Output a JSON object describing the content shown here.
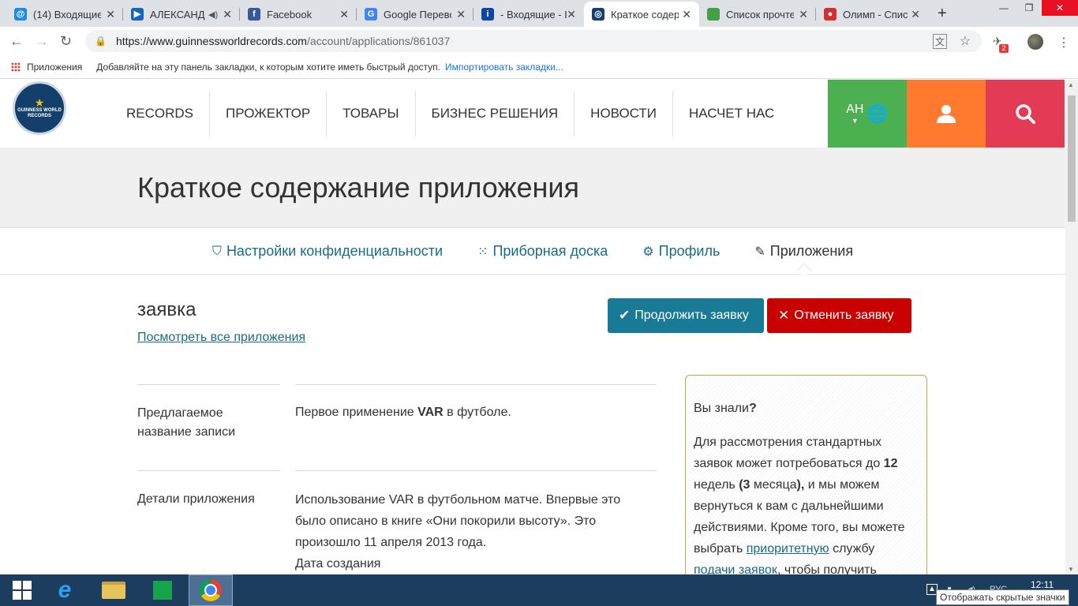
{
  "browser": {
    "tabs": [
      {
        "title": "(14) Входящие",
        "fav_color": "#1e88e5",
        "fav_glyph": "@"
      },
      {
        "title": "АЛЕКСАНД",
        "fav_color": "#1565c0",
        "fav_glyph": "▶"
      },
      {
        "title": "Facebook",
        "fav_color": "#3b5998",
        "fav_glyph": "f"
      },
      {
        "title": "Google Перево",
        "fav_color": "#4285f4",
        "fav_glyph": "G"
      },
      {
        "title": "- Входящие - I",
        "fav_color": "#0d47a1",
        "fav_glyph": "i"
      },
      {
        "title": "Краткое содер",
        "fav_color": "#143f6b",
        "fav_glyph": "◎"
      },
      {
        "title": "Список прочте",
        "fav_color": "#43a047",
        "fav_glyph": ""
      },
      {
        "title": "Олимп - Спис",
        "fav_color": "#d32f2f",
        "fav_glyph": "●"
      }
    ],
    "url_host": "https://www.guinnessworldrecords.com",
    "url_path": "/account/applications/861037",
    "ext_badge": "2",
    "bookmarks_apps": "Приложения",
    "bookmarks_hint": "Добавляйте на эту панель закладки, к которым хотите иметь быстрый доступ.",
    "bookmarks_import": "Импортировать закладки..."
  },
  "site": {
    "logo_text": "GUINNESS WORLD RECORDS",
    "nav": [
      "RECORDS",
      "ПРОЖЕКТОР",
      "ТОВАРЫ",
      "БИЗНЕС РЕШЕНИЯ",
      "НОВОСТИ",
      "НАСЧЕТ НАС"
    ],
    "lang": "АН",
    "page_title": "Краткое содержание приложения",
    "subnav": [
      {
        "label": "Настройки конфиденциальности",
        "icon": "shield-icon"
      },
      {
        "label": "Приборная доска",
        "icon": "grid-icon"
      },
      {
        "label": "Профиль",
        "icon": "gears-icon"
      },
      {
        "label": "Приложения",
        "icon": "edit-icon"
      }
    ],
    "app_heading": "заявка",
    "view_all": "Посмотреть все приложения",
    "continue_btn": "Продолжить заявку",
    "cancel_btn": "Отменить заявку",
    "rows": [
      {
        "label": "Предлагаемое название записи",
        "value_plain": "Первое применение ",
        "value_bold": "VAR",
        "value_rest": " в футболе."
      },
      {
        "label": "Детали приложения",
        "value": "Использование VAR в футбольном матче. Впервые это было описано в книге «Они покорили высоту». Это произошло 11 апреля 2013 года.",
        "value2": "Дата создания"
      }
    ],
    "tip": {
      "q_text": "Вы знали",
      "q_mark": "?",
      "t1": "Для рассмотрения стандартных заявок может потребоваться до ",
      "t1_bold": "12",
      "t2": " недель ",
      "t2_bold": "(3",
      "t3": " месяца",
      "t3_bold": "),",
      "t4": " и мы можем вернуться к вам с дальнейшими действиями. Кроме того, вы можете выбрать ",
      "link1": "приоритетную",
      "t5": "  службу ",
      "link2": "подачи заявок",
      "t6": ", чтобы получить"
    }
  },
  "taskbar": {
    "lang": "РУС",
    "time": "12:11",
    "tooltip": "Отображать скрытые значки"
  }
}
